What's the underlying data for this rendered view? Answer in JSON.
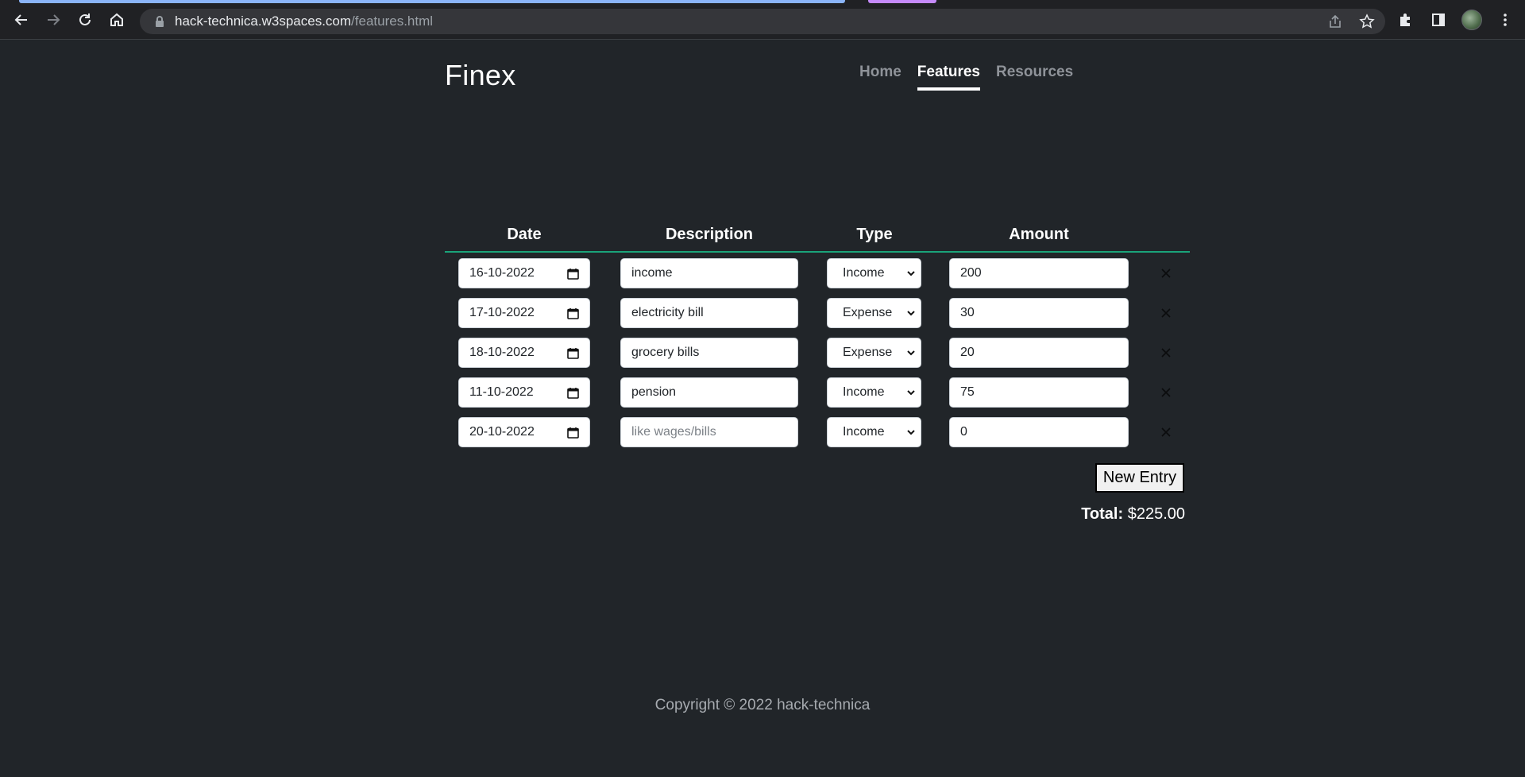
{
  "browser": {
    "url_host": "hack-technica.w3spaces.com",
    "url_path": "/features.html"
  },
  "site": {
    "brand": "Finex",
    "nav": [
      {
        "label": "Home",
        "active": false
      },
      {
        "label": "Features",
        "active": true
      },
      {
        "label": "Resources",
        "active": false
      }
    ]
  },
  "ledger": {
    "headers": {
      "date": "Date",
      "description": "Description",
      "type": "Type",
      "amount": "Amount"
    },
    "rows": [
      {
        "date": "16-10-2022",
        "description": "income",
        "description_placeholder": "",
        "type": "Income",
        "amount": "200"
      },
      {
        "date": "17-10-2022",
        "description": "electricity bill",
        "description_placeholder": "",
        "type": "Expense",
        "amount": "30"
      },
      {
        "date": "18-10-2022",
        "description": "grocery bills",
        "description_placeholder": "",
        "type": "Expense",
        "amount": "20"
      },
      {
        "date": "11-10-2022",
        "description": "pension",
        "description_placeholder": "",
        "type": "Income",
        "amount": "75"
      },
      {
        "date": "20-10-2022",
        "description": "",
        "description_placeholder": "like wages/bills",
        "type": "Income",
        "amount": "0"
      }
    ],
    "new_entry_label": "New Entry",
    "total_label": "Total:",
    "total_value": "$225.00"
  },
  "footer": {
    "copyright": "Copyright © 2022 hack-technica"
  },
  "colors": {
    "background": "#212529",
    "accent_line": "#1aa37a",
    "nav_inactive": "#8f9399"
  },
  "icons": {
    "back": "arrow-left-icon",
    "forward": "arrow-right-icon",
    "reload": "reload-icon",
    "home": "home-icon",
    "lock": "lock-icon",
    "share": "share-icon",
    "star": "star-icon",
    "extensions": "puzzle-icon",
    "sidepanel": "side-panel-icon",
    "menu": "kebab-menu-icon",
    "calendar": "calendar-icon",
    "dropdown": "chevron-down-icon",
    "remove": "close-icon"
  }
}
